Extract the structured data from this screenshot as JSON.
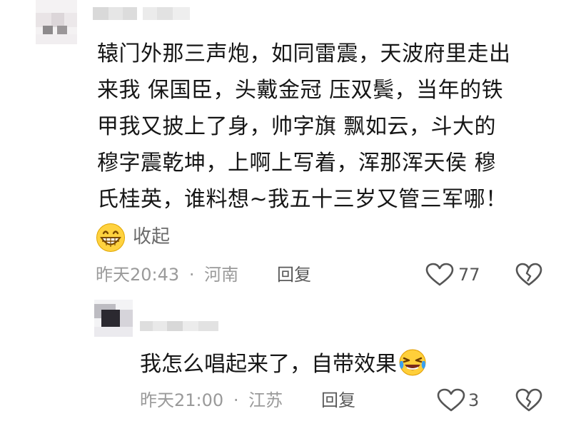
{
  "comment": {
    "lines": [
      "辕门外那三声炮，如同雷震，天波府里走出",
      "来我 保国臣，头戴金冠 压双鬓，当年的铁",
      "甲我又披上了身，帅字旗 飘如云，斗大的",
      "穆字震乾坤，上啊上写着，浑那浑天侯 穆",
      "氏桂英，谁料想~我五十三岁又管三军哪！"
    ],
    "collapse_label": "收起",
    "time": "昨天20:43",
    "sep": "·",
    "location": "河南",
    "reply_label": "回复",
    "like_count": "77"
  },
  "reply": {
    "text": "我怎么唱起来了，自带效果",
    "time": "昨天21:00",
    "sep": "·",
    "location": "江苏",
    "reply_label": "回复",
    "like_count": "3"
  },
  "icons": {
    "grin": "grin-emoji-icon",
    "laugh": "laugh-cry-emoji-icon",
    "heart": "heart-outline-icon",
    "dislike": "broken-heart-icon"
  },
  "colors": {
    "text": "#161616",
    "meta": "#9a9a9a",
    "icon": "#555555"
  }
}
